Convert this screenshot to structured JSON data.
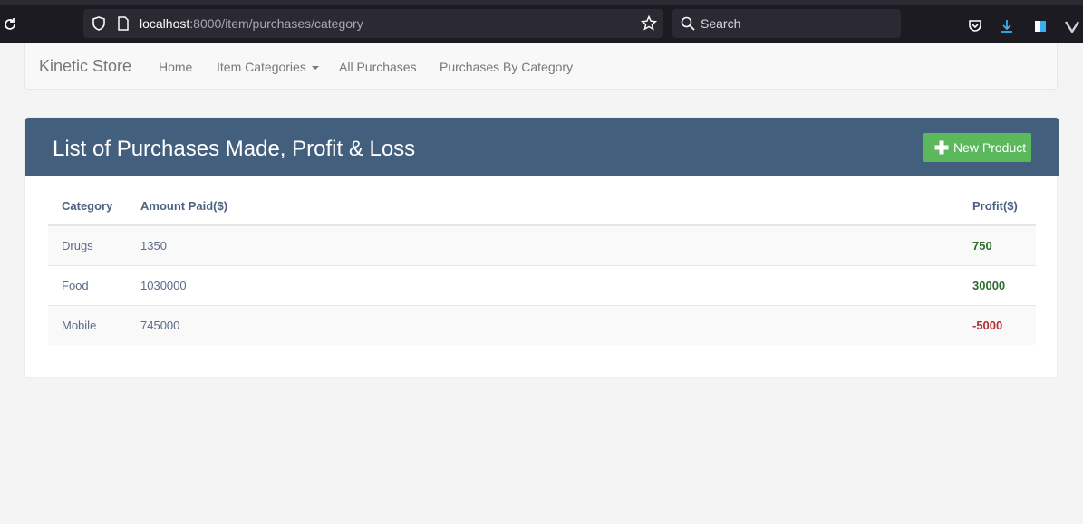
{
  "browser": {
    "url_host": "localhost",
    "url_rest": ":8000/item/purchases/category",
    "search_placeholder": "Search"
  },
  "navbar": {
    "brand": "Kinetic Store",
    "links": [
      "Home",
      "Item Categories",
      "All Purchases",
      "Purchases By Category"
    ]
  },
  "panel": {
    "title": "List of Purchases Made, Profit & Loss",
    "new_button": "New Product",
    "accent": "#435f7e",
    "button_color": "#5cb85c"
  },
  "table": {
    "headers": [
      "Category",
      "Amount Paid($)",
      "Profit($)"
    ],
    "rows": [
      {
        "category": "Drugs",
        "amount": "1350",
        "profit": "750"
      },
      {
        "category": "Food",
        "amount": "1030000",
        "profit": "30000"
      },
      {
        "category": "Mobile",
        "amount": "745000",
        "profit": "-5000"
      }
    ],
    "profit_colors": {
      "positive": "#2e6b2e",
      "negative": "#b03030"
    }
  }
}
